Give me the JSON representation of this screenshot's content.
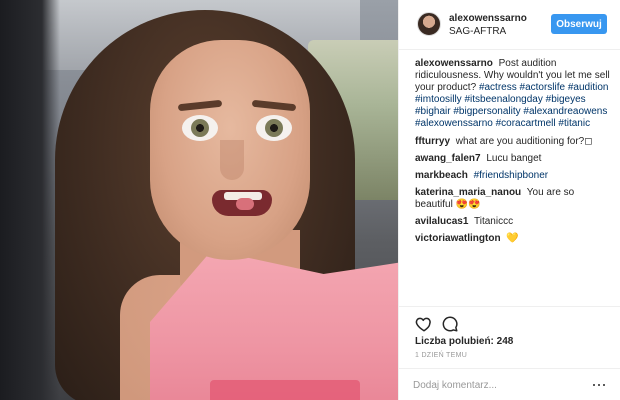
{
  "colors": {
    "accent": "#3897f0",
    "hashtag": "#003569",
    "muted": "#999999"
  },
  "post": {
    "image_alt": "",
    "author": "alexowenssarno",
    "location": "SAG-AFTRA",
    "follow_label": "Obserwuj",
    "caption": {
      "user": "alexowenssarno",
      "text": "Post audition ridiculousness. Why wouldn't you let me sell your product?",
      "hashtags": "#actress #actorslife #audition #imtoosilly #itsbeenalongday #bigeyes #bighair #bigpersonality #alexandreaowens #alexowenssarno #coracartmell #titanic"
    },
    "comments": [
      {
        "user": "ffturryy",
        "text": "what are you auditioning for?◻"
      },
      {
        "user": "awang_falen7",
        "text": "Lucu banget"
      },
      {
        "user": "markbeach",
        "text": "",
        "tag": "#friendshipboner"
      },
      {
        "user": "katerina_maria_nanou",
        "text": "You are so beautiful 😍😍"
      },
      {
        "user": "avilalucas1",
        "text": "Titanicсc"
      },
      {
        "user": "victoriawatlington",
        "text": "💛"
      }
    ],
    "likes_label": "Liczba polubień: 248",
    "timestamp": "1 DZIEŃ TEMU",
    "add_comment_placeholder": "Dodaj komentarz...",
    "icons": [
      "heart-icon",
      "comment-bubble-icon",
      "more-options-icon"
    ]
  }
}
